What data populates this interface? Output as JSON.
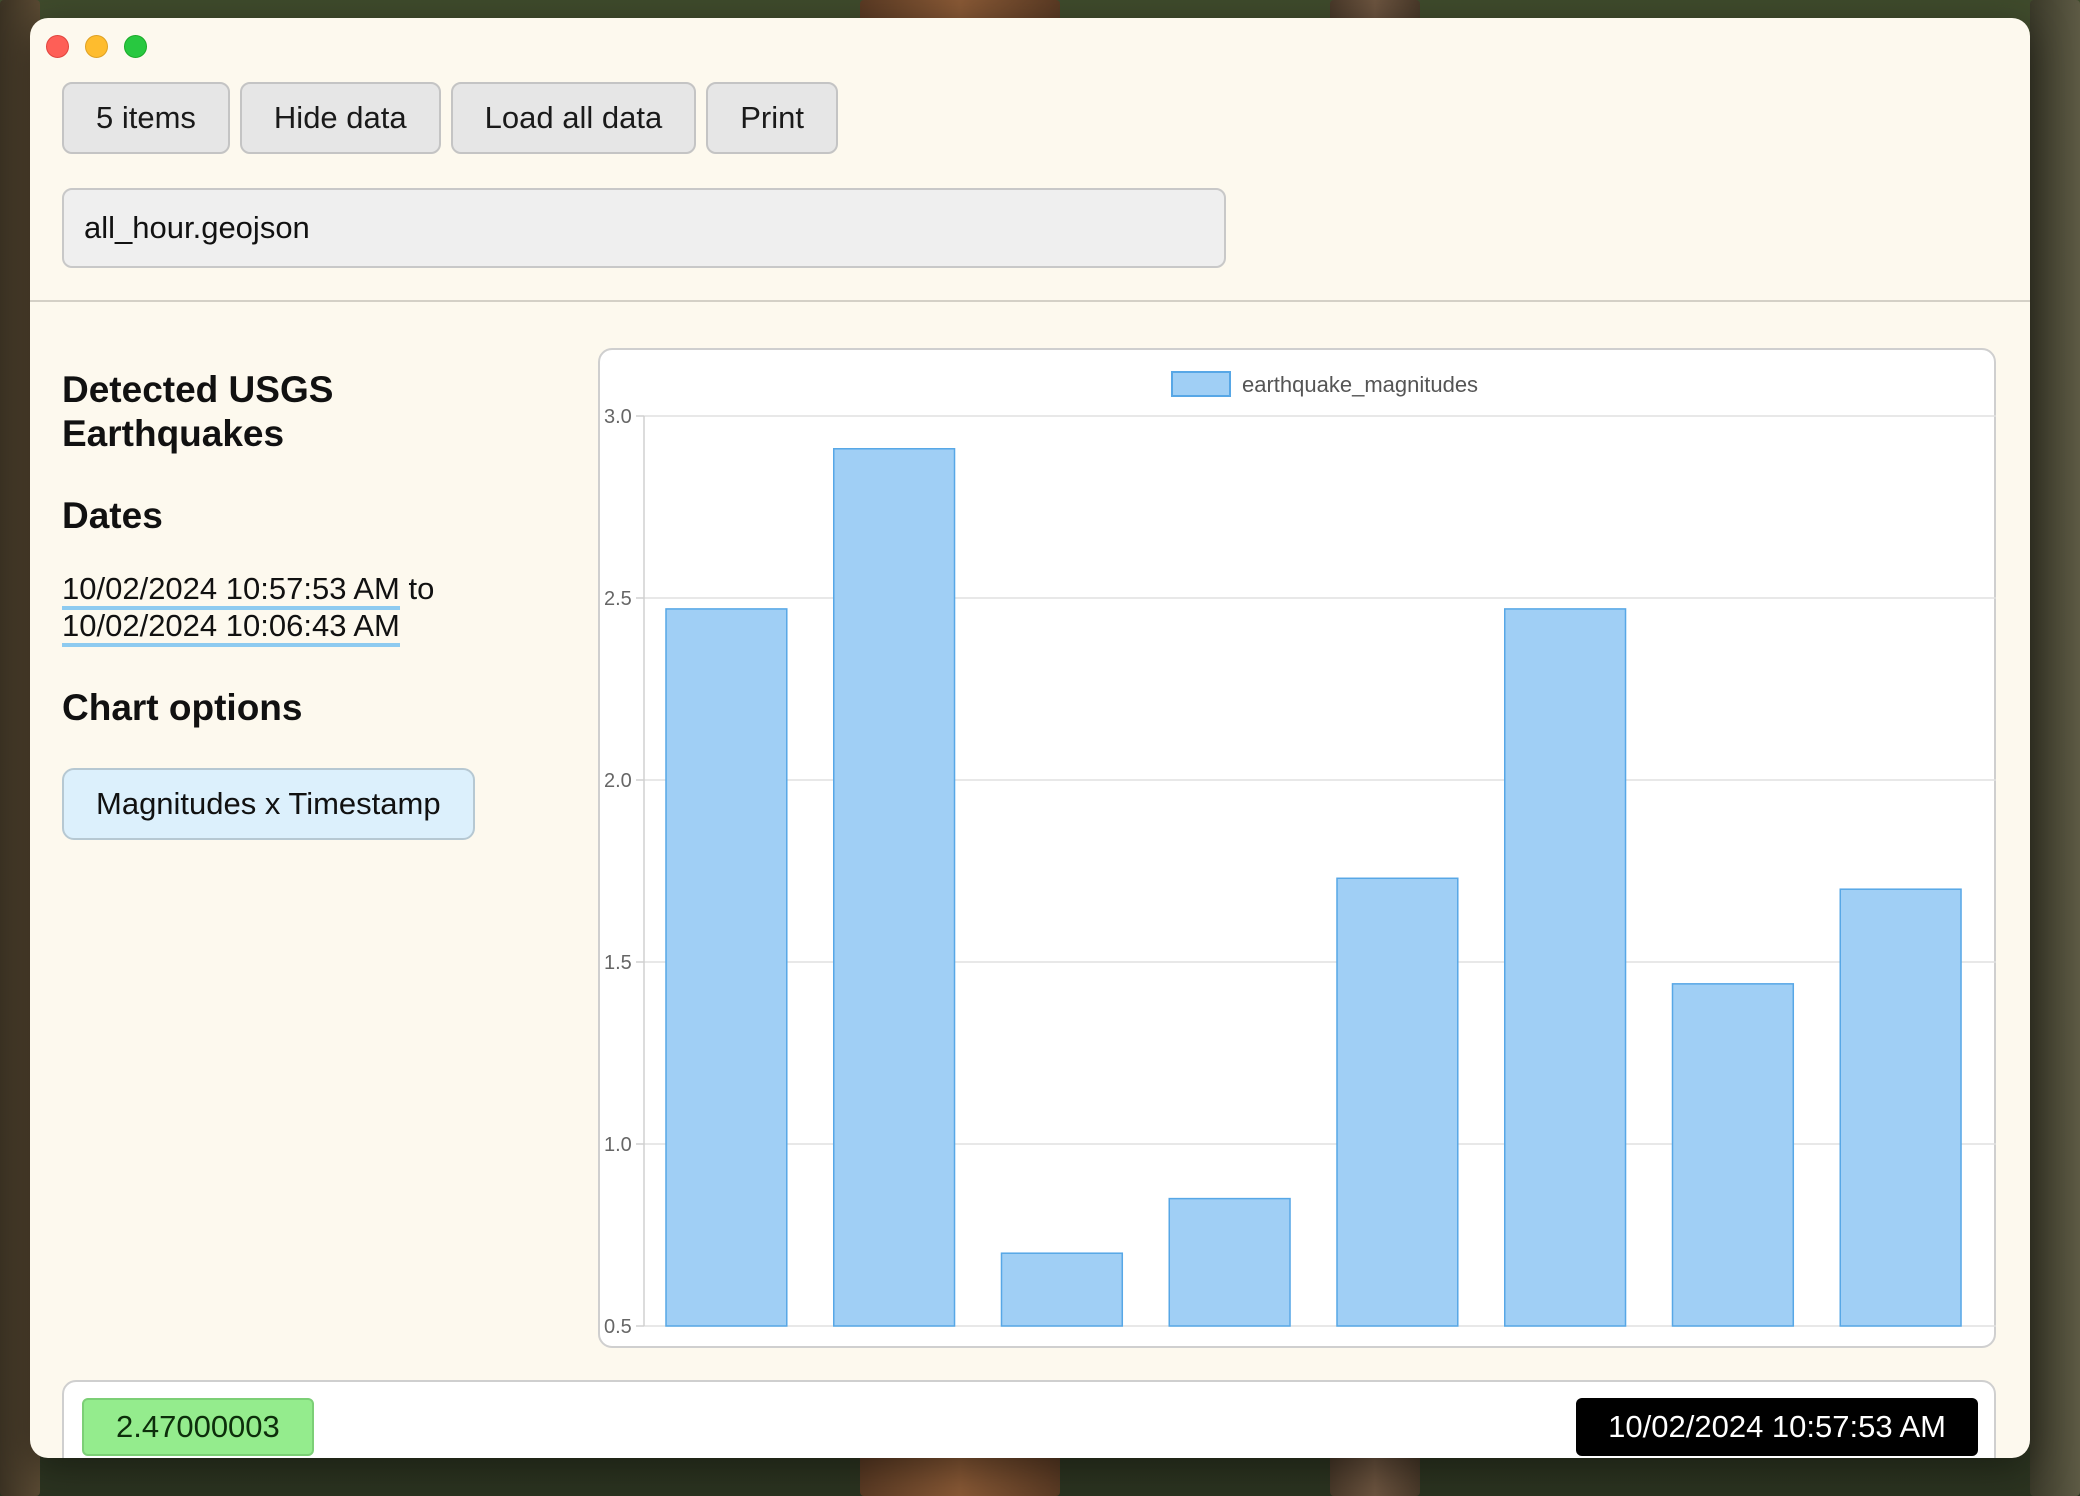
{
  "window": {
    "buttons": {
      "items_label": "5 items",
      "hide_label": "Hide data",
      "load_label": "Load all data",
      "print_label": "Print"
    },
    "file_input_value": "all_hour.geojson"
  },
  "sidebar": {
    "title": "Detected USGS Earthquakes",
    "dates_heading": "Dates",
    "date_start": "10/02/2024 10:57:53 AM",
    "date_to": "to",
    "date_end": "10/02/2024 10:06:43 AM",
    "chart_options_heading": "Chart options",
    "chart_option_button": "Magnitudes x Timestamp"
  },
  "footer": {
    "value": "2.47000003",
    "timestamp": "10/02/2024 10:57:53 AM"
  },
  "colors": {
    "bar_fill": "#a0cff5",
    "bar_stroke": "#57a7e6",
    "window_bg": "#fdf9ee",
    "value_badge": "#94ec8d",
    "chart_option_bg": "#dcf0fc"
  },
  "chart_data": {
    "type": "bar",
    "title": "",
    "xlabel": "",
    "ylabel": "",
    "categories": [
      "",
      "",
      "",
      "",
      "",
      "",
      "",
      ""
    ],
    "series": [
      {
        "name": "earthquake_magnitudes",
        "values": [
          2.47,
          2.91,
          0.7,
          0.85,
          1.73,
          2.47,
          1.44,
          1.7
        ]
      }
    ],
    "ylim": [
      0.5,
      3.0
    ],
    "yticks": [
      "0.5",
      "1.0",
      "1.5",
      "2.0",
      "2.5",
      "3.0"
    ],
    "grid": true,
    "legend": "top"
  }
}
